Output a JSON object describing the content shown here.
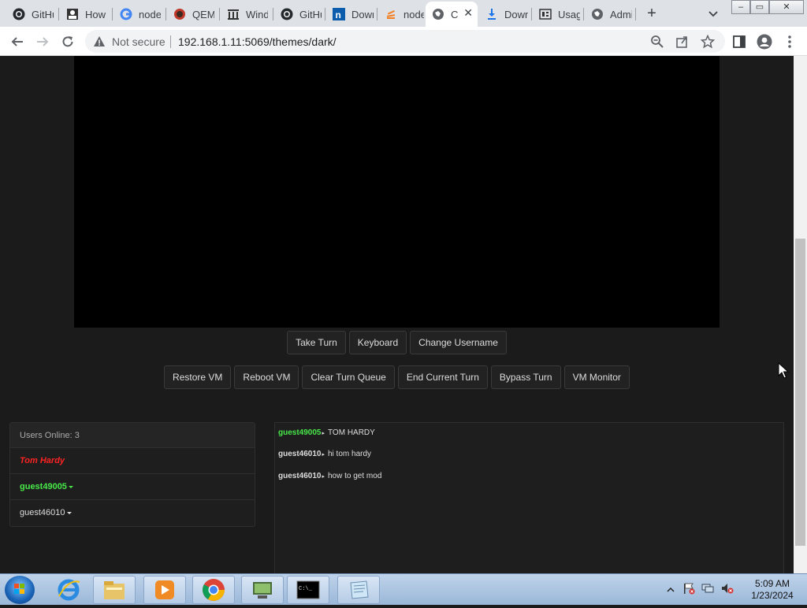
{
  "browser": {
    "tabs": [
      {
        "title": "GitHub",
        "icon": "github-icon"
      },
      {
        "title": "How",
        "icon": "user-icon"
      },
      {
        "title": "node",
        "icon": "google-icon"
      },
      {
        "title": "QEMU",
        "icon": "qemu-icon"
      },
      {
        "title": "Windows",
        "icon": "museum-icon"
      },
      {
        "title": "GitHub",
        "icon": "github-icon"
      },
      {
        "title": "Download",
        "icon": "n-icon"
      },
      {
        "title": "node",
        "icon": "stack-icon"
      },
      {
        "title": "C",
        "icon": "globe-icon",
        "active": true
      },
      {
        "title": "Download",
        "icon": "download-icon"
      },
      {
        "title": "Usage",
        "icon": "book-icon"
      },
      {
        "title": "Admin",
        "icon": "globe-icon"
      }
    ],
    "security_label": "Not secure",
    "url": "192.168.1.11:5069/themes/dark/",
    "window_controls": {
      "minimize": "–",
      "maximize": "▭",
      "close": "✕"
    }
  },
  "vm": {
    "buttons_primary": [
      "Take Turn",
      "Keyboard",
      "Change Username"
    ],
    "buttons_secondary": [
      "Restore VM",
      "Reboot VM",
      "Clear Turn Queue",
      "End Current Turn",
      "Bypass Turn",
      "VM Monitor"
    ]
  },
  "users": {
    "header": "Users Online: 3",
    "list": [
      {
        "name": "Tom Hardy",
        "role": "admin"
      },
      {
        "name": "guest49005",
        "role": "self"
      },
      {
        "name": "guest46010",
        "role": "guest"
      }
    ]
  },
  "chat": {
    "messages": [
      {
        "user": "guest49005",
        "text": "TOM HARDY",
        "self": true
      },
      {
        "user": "guest46010",
        "text": "hi tom hardy",
        "self": false
      },
      {
        "user": "guest46010",
        "text": "how to get mod",
        "self": false
      }
    ]
  },
  "taskbar": {
    "apps": [
      "ie-icon",
      "explorer-icon",
      "media-player-icon",
      "chrome-icon",
      "vm-icon",
      "cmd-icon",
      "notepad-icon"
    ],
    "clock_time": "5:09 AM",
    "clock_date": "1/23/2024"
  },
  "colors": {
    "accent_green": "#48e84a",
    "admin_red": "#ff2222",
    "page_bg": "#1b1b1b"
  }
}
